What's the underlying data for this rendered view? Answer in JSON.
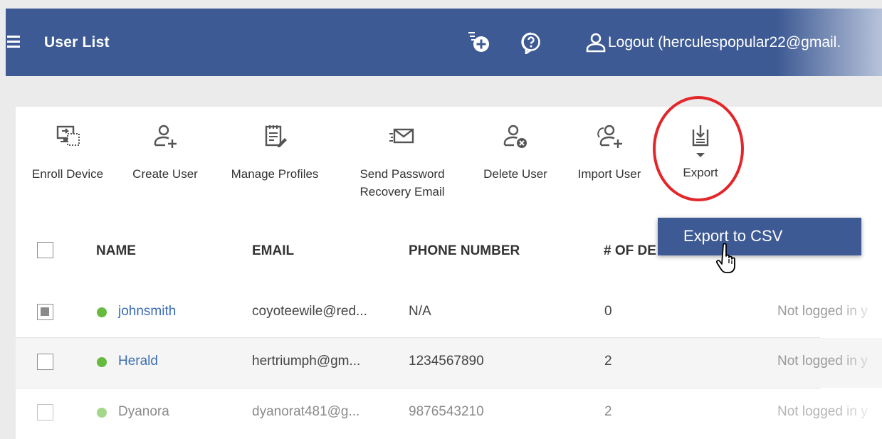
{
  "header": {
    "title": "User List",
    "logout_text": "Logout (herculespopular22@gmail.",
    "icons": [
      "menu-icon",
      "add-task-icon",
      "help-icon",
      "user-icon"
    ],
    "color": "#3d5a94"
  },
  "toolbar": {
    "enroll_device": "Enroll Device",
    "create_user": "Create User",
    "manage_profiles": "Manage Profiles",
    "send_password_line1": "Send Password",
    "send_password_line2": "Recovery Email",
    "delete_user": "Delete User",
    "import_user": "Import User",
    "export": "Export"
  },
  "export_menu": {
    "item": "Export to CSV"
  },
  "table": {
    "headers": {
      "name": "NAME",
      "email": "EMAIL",
      "phone": "PHONE NUMBER",
      "devices": "# OF DE"
    },
    "rows": [
      {
        "name": "johnsmith",
        "email": "coyoteewile@red...",
        "phone": "N/A",
        "devices": "0",
        "last_login": "Not logged in y",
        "status": "online"
      },
      {
        "name": "Herald",
        "email": "hertriumph@gm...",
        "phone": "1234567890",
        "devices": "2",
        "last_login": "Not logged in y",
        "status": "online"
      },
      {
        "name": "Dyanora",
        "email": "dyanorat481@g...",
        "phone": "9876543210",
        "devices": "2",
        "last_login": "Not logged in y",
        "status": "online"
      }
    ]
  },
  "colors": {
    "status_dot": "#66bb3f",
    "highlight_circle": "#e2262a",
    "link": "#3a6cb4"
  }
}
